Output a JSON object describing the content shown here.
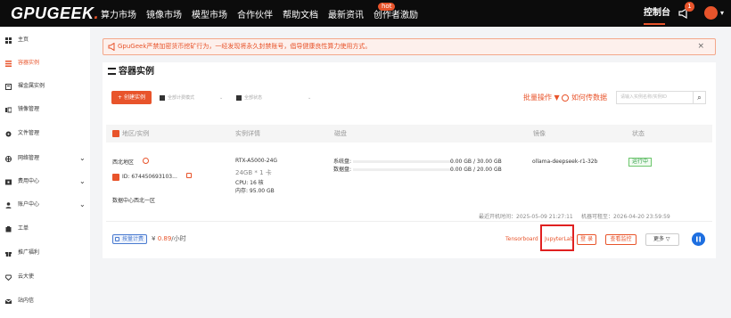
{
  "topbar": {
    "logo": "GPUGEEK",
    "logo_dot": ".",
    "nav": [
      "算力市场",
      "镜像市场",
      "模型市场",
      "合作伙伴",
      "帮助文档",
      "最新资讯",
      "创作者激励"
    ],
    "hot_badge": "hot",
    "console": "控制台",
    "bell_count": "1"
  },
  "sidebar": {
    "items": [
      {
        "label": "主页",
        "icon": "grid-icon",
        "active": false
      },
      {
        "label": "容器实例",
        "icon": "list-icon",
        "active": true
      },
      {
        "label": "裸金属实例",
        "icon": "server-icon",
        "active": false
      },
      {
        "label": "镜像管理",
        "icon": "image-icon",
        "active": false
      },
      {
        "label": "文件管理",
        "icon": "folder-icon",
        "active": false
      },
      {
        "label": "网络管理",
        "icon": "network-icon",
        "active": false,
        "expandable": true
      },
      {
        "label": "费用中心",
        "icon": "wallet-icon",
        "active": false,
        "expandable": true
      },
      {
        "label": "账户中心",
        "icon": "user-icon",
        "active": false,
        "expandable": true
      },
      {
        "label": "工单",
        "icon": "ticket-icon",
        "active": false
      },
      {
        "label": "推广福利",
        "icon": "gift-icon",
        "active": false
      },
      {
        "label": "云大使",
        "icon": "diamond-icon",
        "active": false
      },
      {
        "label": "站内信",
        "icon": "mail-icon",
        "active": false
      }
    ]
  },
  "warning": {
    "text": "GpuGeek严禁加密货币挖矿行为，一经发现将永久封禁账号，倡导健康良性算力使用方式。",
    "close": "×"
  },
  "panel": {
    "title": "容器实例",
    "create_button": "+ 创建实例",
    "filter_billing": "全部计费模式",
    "filter_status": "全部状态",
    "batch_ops": "批量操作 ▼",
    "howto": "如何传数据",
    "search_placeholder": "请输入实例名称/实例ID",
    "columns": [
      "地区/实例",
      "实例详情",
      "磁盘",
      "镜像",
      "状态"
    ]
  },
  "instance": {
    "region": "西北地区",
    "id": "ID: 674450693103...",
    "zone": "数据中心西北一区",
    "gpu": "RTX-A5000-24G",
    "gpu_mem": "24GB * 1 卡",
    "cpu": "CPU: 16 核",
    "mem": "内存: 95.00 GB",
    "disk_sys_label": "系统盘:",
    "disk_sys_value": "0.00 GB / 30.00 GB",
    "disk_data_label": "数据盘:",
    "disk_data_value": "0.00 GB / 20.00 GB",
    "disk_sys_used": 0.0,
    "disk_data_used": 0.0,
    "image": "ollama-deepseek-r1-32b",
    "status": "运行中",
    "last_start": "最近开机时间：2025-05-09 21:27:11",
    "expire": "机器可租至：2026-04-20 23:59:59",
    "billing_badge": "按量计费",
    "price_symbol": "¥ ",
    "price": "0.89",
    "price_unit": "/小时",
    "tensorboard": "Tensorboard",
    "jupyterlab": "JupyterLab",
    "login": "登 录",
    "monitor": "查看监控",
    "more": "更多 ▽"
  },
  "colors": {
    "accent": "#e8542b",
    "running": "#2f9e44",
    "blue": "#1e6fe0",
    "highlight": "#e02020"
  }
}
